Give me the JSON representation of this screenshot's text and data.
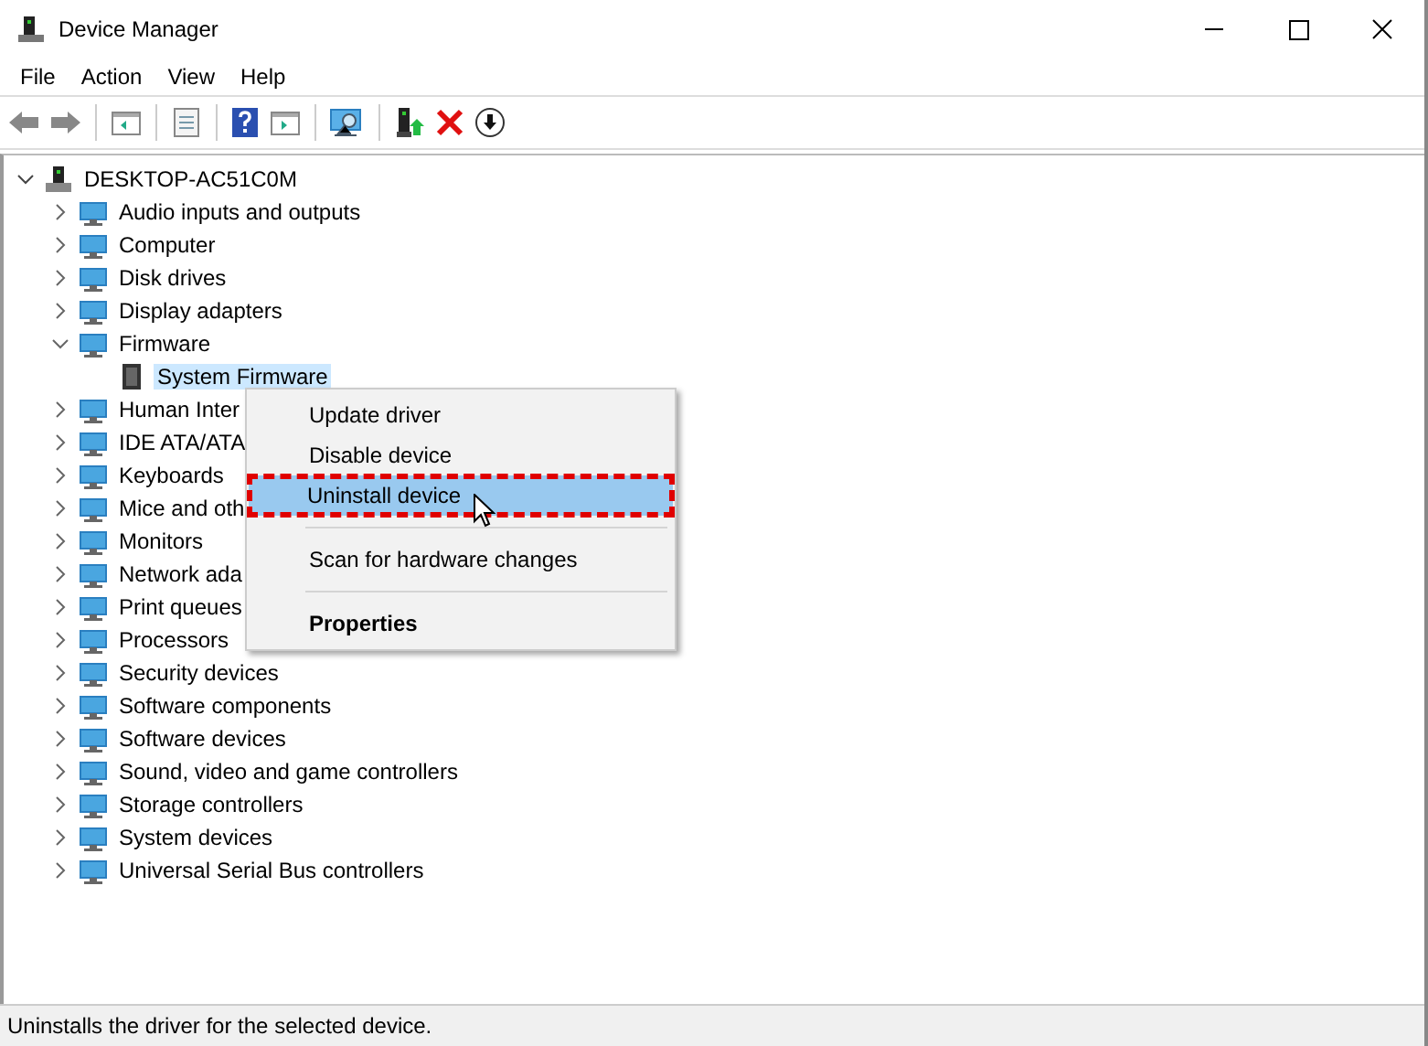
{
  "window": {
    "title": "Device Manager"
  },
  "menu_bar": [
    "File",
    "Action",
    "View",
    "Help"
  ],
  "tree": {
    "label": "DESKTOP-AC51C0M",
    "expanded": true,
    "children": [
      {
        "label": "Audio inputs and outputs",
        "expanded": false
      },
      {
        "label": "Computer",
        "expanded": false
      },
      {
        "label": "Disk drives",
        "expanded": false
      },
      {
        "label": "Display adapters",
        "expanded": false
      },
      {
        "label": "Firmware",
        "expanded": true,
        "children": [
          {
            "label": "System Firmware",
            "selected": true
          }
        ]
      },
      {
        "label": "Human Inter",
        "expanded": false
      },
      {
        "label": "IDE ATA/ATA",
        "expanded": false
      },
      {
        "label": "Keyboards",
        "expanded": false
      },
      {
        "label": "Mice and oth",
        "expanded": false
      },
      {
        "label": "Monitors",
        "expanded": false
      },
      {
        "label": "Network ada",
        "expanded": false
      },
      {
        "label": "Print queues",
        "expanded": false
      },
      {
        "label": "Processors",
        "expanded": false
      },
      {
        "label": "Security devices",
        "expanded": false
      },
      {
        "label": "Software components",
        "expanded": false
      },
      {
        "label": "Software devices",
        "expanded": false
      },
      {
        "label": "Sound, video and game controllers",
        "expanded": false
      },
      {
        "label": "Storage controllers",
        "expanded": false
      },
      {
        "label": "System devices",
        "expanded": false
      },
      {
        "label": "Universal Serial Bus controllers",
        "expanded": false
      }
    ]
  },
  "context_menu": [
    {
      "kind": "item",
      "label": "Update driver",
      "selected": false,
      "default": false
    },
    {
      "kind": "item",
      "label": "Disable device",
      "selected": false,
      "default": false
    },
    {
      "kind": "item",
      "label": "Uninstall device",
      "selected": true,
      "default": false
    },
    {
      "kind": "separator"
    },
    {
      "kind": "item",
      "label": "Scan for hardware changes",
      "selected": false,
      "default": false
    },
    {
      "kind": "separator"
    },
    {
      "kind": "item",
      "label": "Properties",
      "selected": false,
      "default": true
    }
  ],
  "status_bar": "Uninstalls the driver for the selected device."
}
